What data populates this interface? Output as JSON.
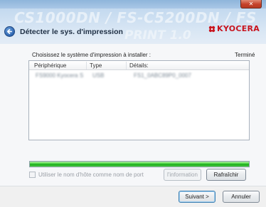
{
  "window": {
    "title": "Détecter le sys. d'impression",
    "close_glyph": "✕",
    "watermark_line1": "CS1000DN / FS-C5200DN / FS",
    "watermark_line2": "PRINT 1.0"
  },
  "brand": {
    "name": "KYOCERA",
    "accent": "#c8141e"
  },
  "prompt": "Choisissez le système d'impression à installer :",
  "status": "Terminé",
  "table": {
    "columns": [
      "Périphérique",
      "Type",
      "Détails:"
    ],
    "rows": [
      [
        "FS9000 Kyocera S",
        "USB",
        "FS1_0ABC89P0_0007"
      ]
    ]
  },
  "progress": {
    "value": 1.0,
    "color": "#18a81a"
  },
  "checkbox": {
    "label": "Utiliser le nom d'hôte comme nom de port",
    "checked": false,
    "enabled": false
  },
  "buttons": {
    "info": "l'information",
    "refresh": "Rafraîchir",
    "next": "Suivant >",
    "cancel": "Annuler"
  }
}
